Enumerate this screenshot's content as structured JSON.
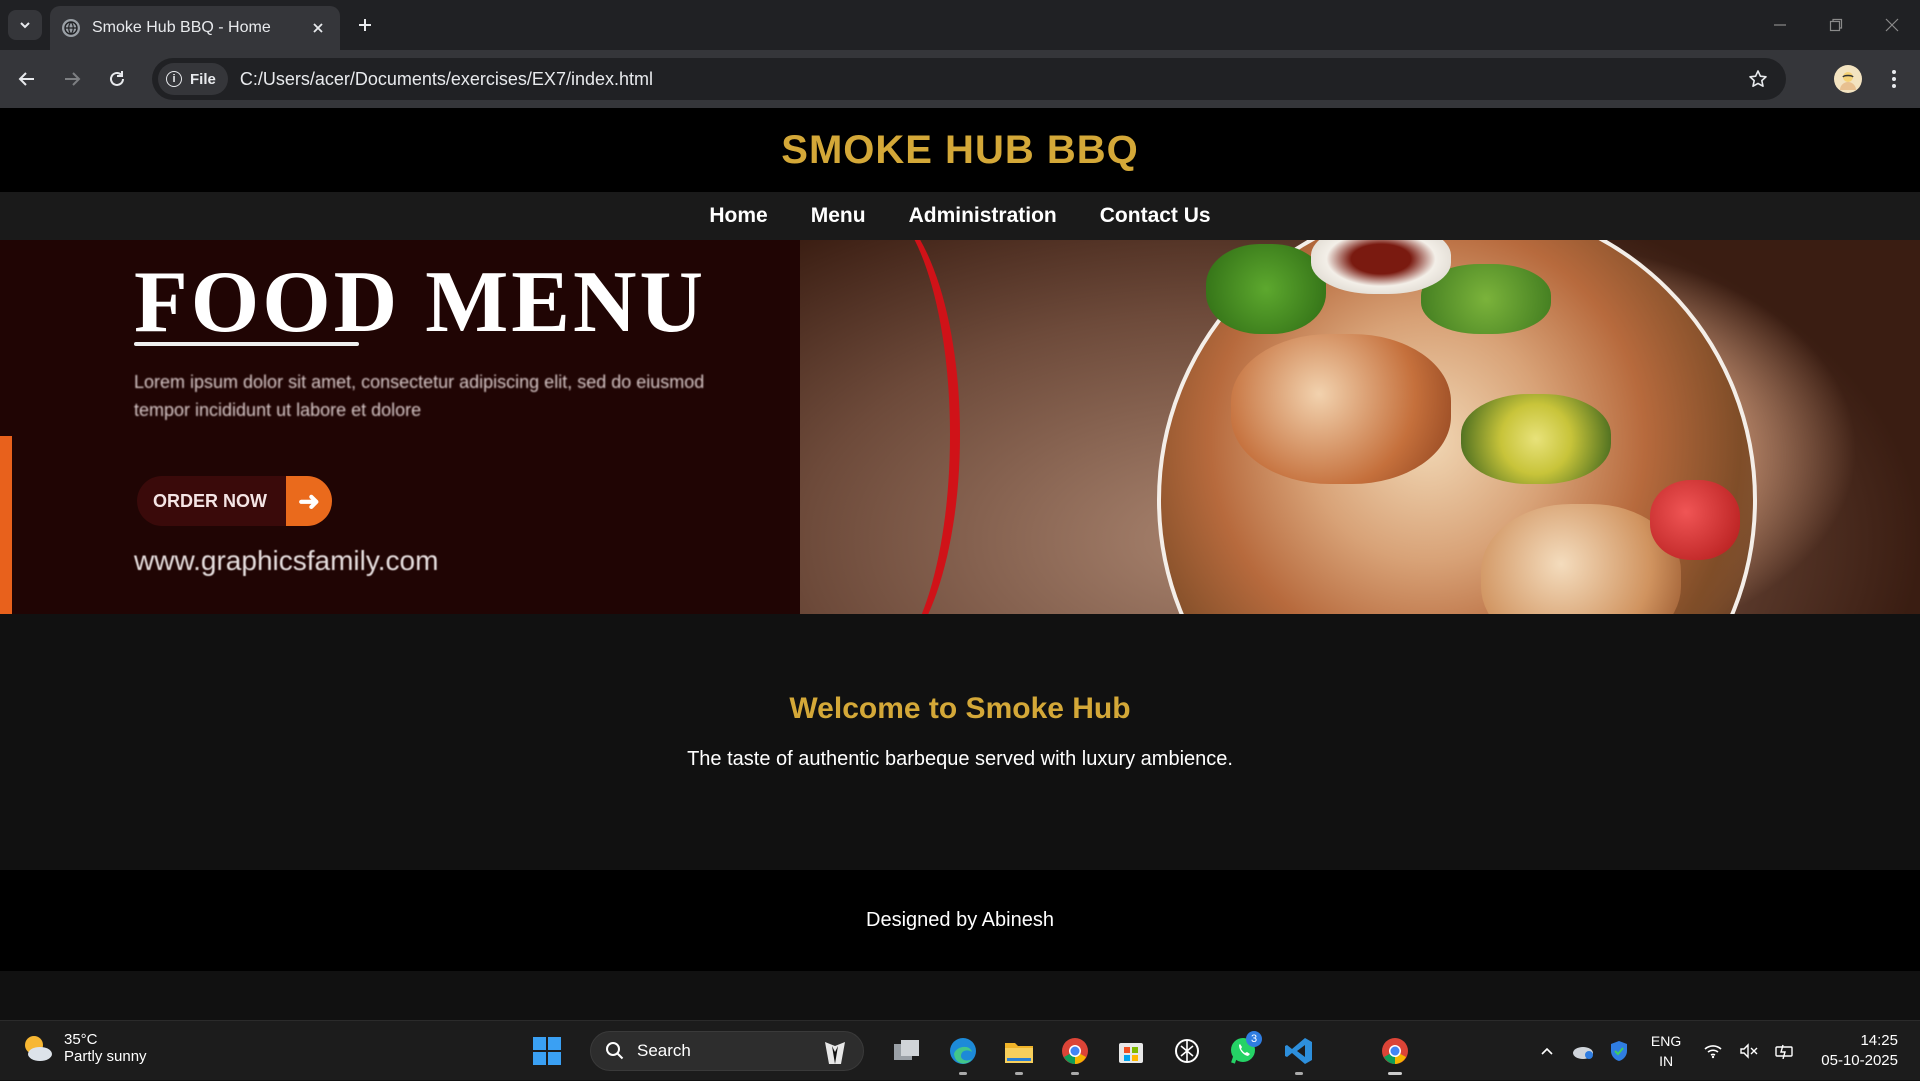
{
  "browser": {
    "tab_title": "Smoke Hub BBQ - Home",
    "chip_label": "File",
    "url": "C:/Users/acer/Documents/exercises/EX7/index.html"
  },
  "site": {
    "title": "SMOKE HUB BBQ",
    "nav": [
      "Home",
      "Menu",
      "Administration",
      "Contact Us"
    ],
    "banner": {
      "heading": "FOOD MENU",
      "text": "Lorem ipsum dolor sit amet, consectetur adipiscing elit, sed do eiusmod tempor incididunt ut labore et dolore",
      "button": "ORDER NOW",
      "url": "www.graphicsfamily.com"
    },
    "welcome": {
      "heading": "Welcome to Smoke Hub",
      "text": "The taste of authentic barbeque served with luxury ambience."
    },
    "footer": "Designed by Abinesh"
  },
  "taskbar": {
    "weather_temp": "35°C",
    "weather_desc": "Partly sunny",
    "search_label": "Search",
    "whatsapp_badge": "3",
    "lang_1": "ENG",
    "lang_2": "IN",
    "time": "14:25",
    "date": "05-10-2025"
  },
  "colors": {
    "accent_gold": "#d4a838",
    "header_bg": "#000000",
    "page_bg": "#111111"
  }
}
